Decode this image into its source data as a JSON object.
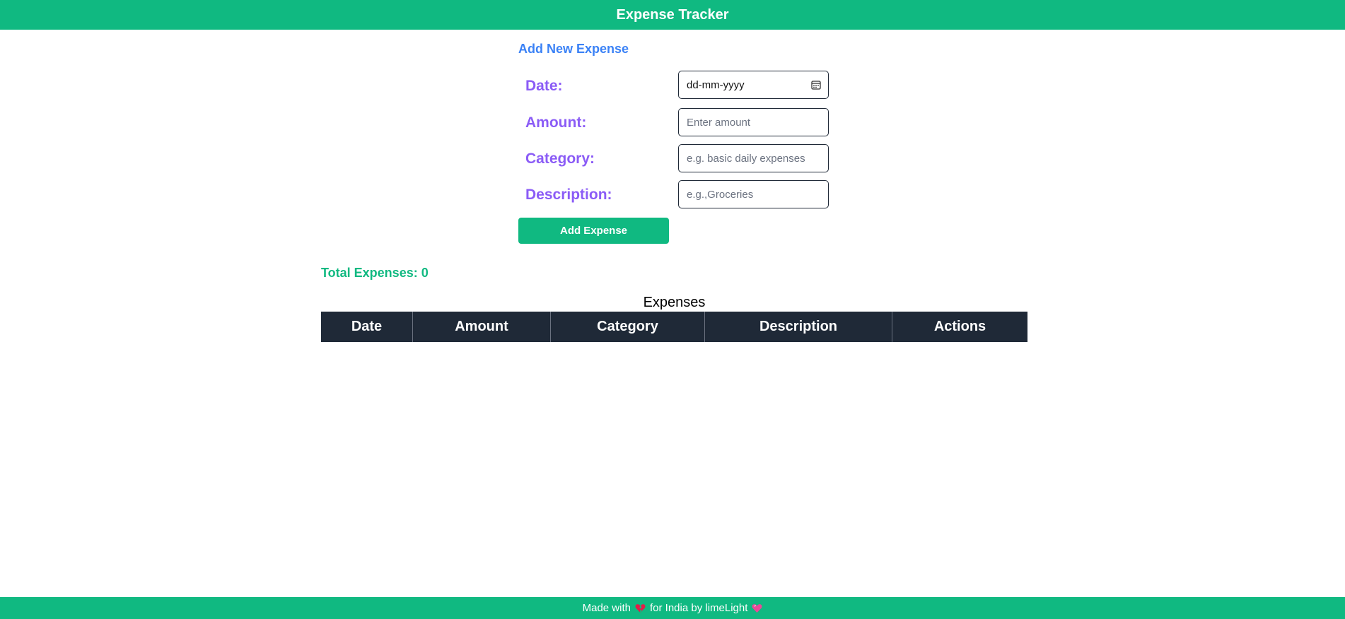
{
  "header": {
    "title": "Expense Tracker"
  },
  "form": {
    "title": "Add New Expense",
    "date_label": "Date:",
    "date_value": "dd-mm-yyyy",
    "amount_label": "Amount:",
    "amount_placeholder": "Enter amount",
    "category_label": "Category:",
    "category_placeholder": "e.g. basic daily expenses",
    "description_label": "Description:",
    "description_placeholder": "e.g.,Groceries",
    "submit_label": "Add Expense"
  },
  "summary": {
    "total_text": "Total Expenses: 0"
  },
  "table": {
    "caption": "Expenses",
    "headers": [
      "Date",
      "Amount",
      "Category",
      "Description",
      "Actions"
    ]
  },
  "footer": {
    "prefix": "Made with",
    "middle": "for India by limeLight"
  },
  "colors": {
    "brand": "#10b981",
    "heading": "#3b82f6",
    "label": "#8b5cf6",
    "table_header": "#1f2937"
  },
  "icons": [
    "calendar-icon",
    "broken-heart-icon",
    "heart-icon"
  ]
}
